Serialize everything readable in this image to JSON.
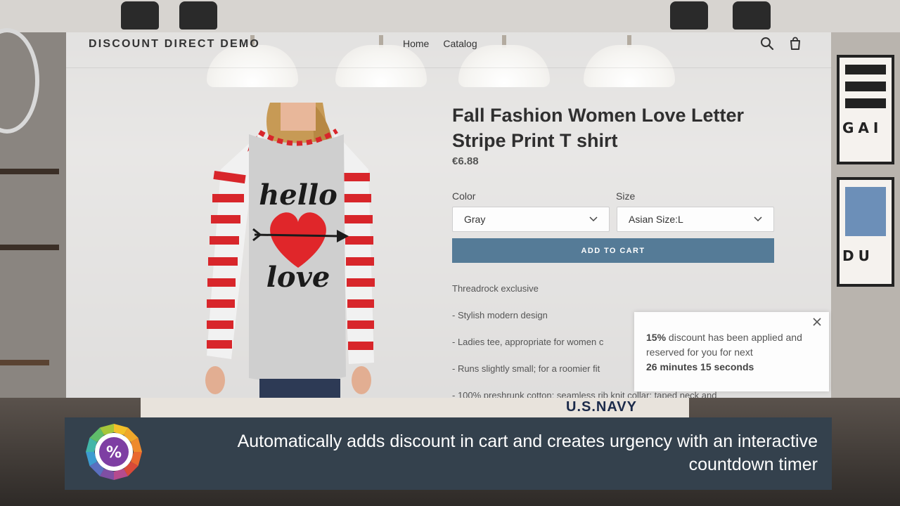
{
  "store": {
    "brand": "DISCOUNT DIRECT DEMO",
    "nav": [
      "Home",
      "Catalog"
    ],
    "icons": {
      "search": "search-icon",
      "cart": "cart-icon"
    }
  },
  "product": {
    "title": "Fall Fashion Women Love Letter Stripe Print T shirt",
    "price": "€6.88",
    "image_text": {
      "line1": "hello",
      "line2": "love"
    },
    "options": {
      "color": {
        "label": "Color",
        "value": "Gray"
      },
      "size": {
        "label": "Size",
        "value": "Asian Size:L"
      }
    },
    "add_to_cart": "ADD TO CART",
    "description": [
      "Threadrock exclusive",
      "- Stylish modern design",
      "- Ladies tee, appropriate for women c",
      "- Runs slightly small; for a roomier fit",
      "- 100% preshrunk cotton; seamless rib knit collar; taped neck and"
    ]
  },
  "popup": {
    "percent": "15%",
    "text1": " discount has been applied and reserved for you for next",
    "countdown": "26 minutes 15 seconds"
  },
  "banner": {
    "caption": "Automatically adds discount in cart and creates urgency with an interactive countdown timer",
    "logo_symbol": "%"
  },
  "background": {
    "frame_letters_top": "GAI",
    "frame_letters_bottom": "DU",
    "rug_text": "U.S.NAVY"
  },
  "colors": {
    "button": "#557b97",
    "banner": "#34414d",
    "heart": "#e0262a",
    "stripe": "#d8262b"
  }
}
